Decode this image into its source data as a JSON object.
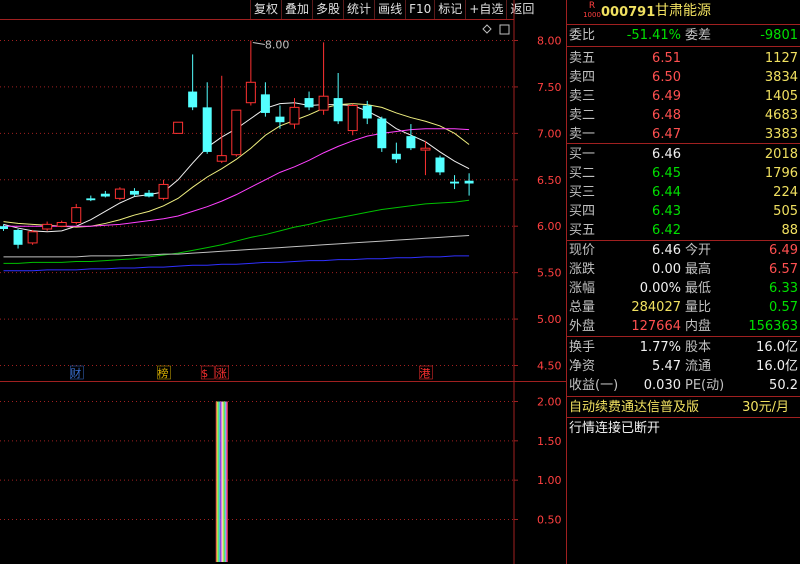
{
  "toolbar": [
    "复权",
    "叠加",
    "多股",
    "统计",
    "画线",
    "F10",
    "标记",
    "+自选",
    "返回"
  ],
  "stock": {
    "badge_top": "R",
    "badge_bottom": "1000",
    "code": "000791",
    "name": "甘肃能源"
  },
  "order_ratio": {
    "label1": "委比",
    "value1": "-51.41%",
    "label2": "委差",
    "value2": "-9801"
  },
  "sell": [
    {
      "label": "卖五",
      "price": "6.51",
      "vol": "1127"
    },
    {
      "label": "卖四",
      "price": "6.50",
      "vol": "3834"
    },
    {
      "label": "卖三",
      "price": "6.49",
      "vol": "1405"
    },
    {
      "label": "卖二",
      "price": "6.48",
      "vol": "4683"
    },
    {
      "label": "卖一",
      "price": "6.47",
      "vol": "3383"
    }
  ],
  "buy": [
    {
      "label": "买一",
      "price": "6.46",
      "vol": "2018"
    },
    {
      "label": "买二",
      "price": "6.45",
      "vol": "1796"
    },
    {
      "label": "买三",
      "price": "6.44",
      "vol": "224"
    },
    {
      "label": "买四",
      "price": "6.43",
      "vol": "505"
    },
    {
      "label": "买五",
      "price": "6.42",
      "vol": "88"
    }
  ],
  "quote": [
    {
      "l1": "现价",
      "v1": "6.46",
      "l2": "今开",
      "v2": "6.49",
      "c1": "wht",
      "c2": "red"
    },
    {
      "l1": "涨跌",
      "v1": "0.00",
      "l2": "最高",
      "v2": "6.57",
      "c1": "wht",
      "c2": "red"
    },
    {
      "l1": "涨幅",
      "v1": "0.00%",
      "l2": "最低",
      "v2": "6.33",
      "c1": "wht",
      "c2": "grn"
    },
    {
      "l1": "总量",
      "v1": "284027",
      "l2": "量比",
      "v2": "0.57",
      "c1": "yel",
      "c2": "grn"
    },
    {
      "l1": "外盘",
      "v1": "127664",
      "l2": "内盘",
      "v2": "156363",
      "c1": "red",
      "c2": "grn"
    }
  ],
  "fundamentals": [
    {
      "l1": "换手",
      "v1": "1.77%",
      "l2": "股本",
      "v2": "16.0亿"
    },
    {
      "l1": "净资",
      "v1": "5.47",
      "l2": "流通",
      "v2": "16.0亿"
    },
    {
      "l1": "收益(一)",
      "v1": "0.030",
      "l2": "PE(动)",
      "v2": "50.2"
    }
  ],
  "promo": {
    "text": "自动续费通达信普及版",
    "price": "30元/月"
  },
  "status": "行情连接已断开",
  "colors": {
    "up": "#ff3232",
    "down": "#54ffff",
    "grid": "#a02020",
    "ma5": "#f0f0f0",
    "ma10": "#f0f080",
    "ma20": "#ff40ff",
    "ma60": "#00c000",
    "ma120": "#c0c0c0",
    "ma250": "#3030ff"
  },
  "chart_data": {
    "type": "candlestick",
    "y_ticks": [
      "8.00",
      "7.50",
      "7.00",
      "6.50",
      "6.00",
      "5.50",
      "5.00",
      "4.50"
    ],
    "ylim": [
      4.45,
      8.05
    ],
    "high_annotation": "8.00",
    "candles": [
      {
        "o": 6.0,
        "c": 5.97,
        "h": 6.02,
        "l": 5.95
      },
      {
        "o": 5.96,
        "c": 5.8,
        "h": 5.97,
        "l": 5.76
      },
      {
        "o": 5.82,
        "c": 5.94,
        "h": 5.96,
        "l": 5.8
      },
      {
        "o": 5.97,
        "c": 6.02,
        "h": 6.05,
        "l": 5.95
      },
      {
        "o": 6.0,
        "c": 6.04,
        "h": 6.06,
        "l": 5.99
      },
      {
        "o": 6.04,
        "c": 6.2,
        "h": 6.24,
        "l": 6.02
      },
      {
        "o": 6.3,
        "c": 6.28,
        "h": 6.33,
        "l": 6.27
      },
      {
        "o": 6.35,
        "c": 6.32,
        "h": 6.38,
        "l": 6.31
      },
      {
        "o": 6.3,
        "c": 6.4,
        "h": 6.42,
        "l": 6.28
      },
      {
        "o": 6.38,
        "c": 6.34,
        "h": 6.41,
        "l": 6.32
      },
      {
        "o": 6.36,
        "c": 6.32,
        "h": 6.39,
        "l": 6.31
      },
      {
        "o": 6.3,
        "c": 6.45,
        "h": 6.5,
        "l": 6.28
      },
      {
        "o": 7.0,
        "c": 7.12,
        "h": 7.12,
        "l": 7.0
      },
      {
        "o": 7.45,
        "c": 7.28,
        "h": 7.85,
        "l": 7.25
      },
      {
        "o": 7.28,
        "c": 6.8,
        "h": 7.55,
        "l": 6.78
      },
      {
        "o": 6.7,
        "c": 6.76,
        "h": 7.62,
        "l": 6.68
      },
      {
        "o": 6.77,
        "c": 7.25,
        "h": 7.25,
        "l": 6.75
      },
      {
        "o": 7.33,
        "c": 7.55,
        "h": 8.0,
        "l": 7.3
      },
      {
        "o": 7.42,
        "c": 7.22,
        "h": 7.55,
        "l": 7.18
      },
      {
        "o": 7.18,
        "c": 7.12,
        "h": 7.3,
        "l": 7.05
      },
      {
        "o": 7.1,
        "c": 7.28,
        "h": 7.38,
        "l": 7.05
      },
      {
        "o": 7.38,
        "c": 7.28,
        "h": 7.45,
        "l": 7.25
      },
      {
        "o": 7.25,
        "c": 7.4,
        "h": 7.98,
        "l": 7.2
      },
      {
        "o": 7.38,
        "c": 7.13,
        "h": 7.65,
        "l": 7.1
      },
      {
        "o": 7.03,
        "c": 7.3,
        "h": 7.32,
        "l": 6.98
      },
      {
        "o": 7.3,
        "c": 7.16,
        "h": 7.35,
        "l": 7.1
      },
      {
        "o": 7.16,
        "c": 6.84,
        "h": 7.18,
        "l": 6.8
      },
      {
        "o": 6.78,
        "c": 6.72,
        "h": 6.9,
        "l": 6.68
      },
      {
        "o": 6.97,
        "c": 6.84,
        "h": 7.1,
        "l": 6.82
      },
      {
        "o": 6.82,
        "c": 6.84,
        "h": 6.92,
        "l": 6.55
      },
      {
        "o": 6.74,
        "c": 6.58,
        "h": 6.76,
        "l": 6.55
      },
      {
        "o": 6.48,
        "c": 6.46,
        "h": 6.55,
        "l": 6.4
      },
      {
        "o": 6.49,
        "c": 6.46,
        "h": 6.57,
        "l": 6.33
      }
    ],
    "ma": [
      {
        "name": "ma5",
        "values": [
          6.02,
          5.98,
          5.95,
          5.94,
          5.95,
          6.0,
          6.07,
          6.16,
          6.25,
          6.32,
          6.34,
          6.37,
          6.5,
          6.68,
          6.85,
          6.96,
          7.05,
          7.16,
          7.27,
          7.32,
          7.33,
          7.3,
          7.31,
          7.31,
          7.3,
          7.24,
          7.16,
          7.05,
          6.98,
          6.91,
          6.8,
          6.7,
          6.62
        ]
      },
      {
        "name": "ma10",
        "values": [
          6.05,
          6.03,
          6.02,
          6.01,
          6.0,
          5.99,
          6.0,
          6.03,
          6.07,
          6.12,
          6.16,
          6.22,
          6.3,
          6.42,
          6.53,
          6.62,
          6.72,
          6.84,
          6.98,
          7.08,
          7.14,
          7.2,
          7.27,
          7.31,
          7.32,
          7.31,
          7.28,
          7.22,
          7.17,
          7.13,
          7.08,
          7.0,
          6.88
        ]
      },
      {
        "name": "ma20",
        "values": [
          6.0,
          6.0,
          6.0,
          6.0,
          6.0,
          6.0,
          6.0,
          6.01,
          6.02,
          6.04,
          6.06,
          6.08,
          6.11,
          6.16,
          6.21,
          6.27,
          6.34,
          6.42,
          6.5,
          6.58,
          6.64,
          6.71,
          6.79,
          6.86,
          6.92,
          6.97,
          7.0,
          7.02,
          7.04,
          7.05,
          7.05,
          7.05,
          7.04
        ]
      },
      {
        "name": "ma60",
        "values": [
          5.6,
          5.6,
          5.61,
          5.61,
          5.61,
          5.62,
          5.62,
          5.63,
          5.64,
          5.65,
          5.67,
          5.69,
          5.71,
          5.74,
          5.77,
          5.8,
          5.84,
          5.88,
          5.91,
          5.95,
          5.99,
          6.02,
          6.06,
          6.09,
          6.12,
          6.15,
          6.18,
          6.2,
          6.22,
          6.24,
          6.25,
          6.26,
          6.28
        ]
      },
      {
        "name": "ma120",
        "values": [
          5.67,
          5.67,
          5.67,
          5.67,
          5.67,
          5.67,
          5.68,
          5.68,
          5.68,
          5.69,
          5.69,
          5.7,
          5.7,
          5.71,
          5.72,
          5.73,
          5.74,
          5.75,
          5.76,
          5.77,
          5.78,
          5.79,
          5.8,
          5.81,
          5.82,
          5.83,
          5.84,
          5.85,
          5.86,
          5.87,
          5.88,
          5.89,
          5.9
        ]
      },
      {
        "name": "ma250",
        "values": [
          5.52,
          5.52,
          5.52,
          5.53,
          5.53,
          5.53,
          5.54,
          5.54,
          5.55,
          5.55,
          5.56,
          5.56,
          5.57,
          5.58,
          5.58,
          5.59,
          5.59,
          5.6,
          5.61,
          5.61,
          5.62,
          5.63,
          5.63,
          5.64,
          5.64,
          5.65,
          5.65,
          5.66,
          5.66,
          5.67,
          5.67,
          5.68,
          5.68
        ]
      }
    ],
    "event_tags": [
      {
        "text": "财",
        "index": 5,
        "color": "#3a6fd0"
      },
      {
        "text": "榜",
        "index": 11,
        "color": "#d8b000"
      },
      {
        "text": "$",
        "index": 14,
        "color": "#ff3030"
      },
      {
        "text": "涨",
        "index": 15,
        "color": "#ff3030"
      },
      {
        "text": "港",
        "index": 29,
        "color": "#ff3030"
      }
    ],
    "indicator": {
      "y_ticks": [
        "2.00",
        "1.50",
        "1.00",
        "0.50"
      ],
      "ylim": [
        0,
        2.05
      ],
      "bars": [
        {
          "index": 15,
          "value": 2.0
        }
      ]
    }
  }
}
